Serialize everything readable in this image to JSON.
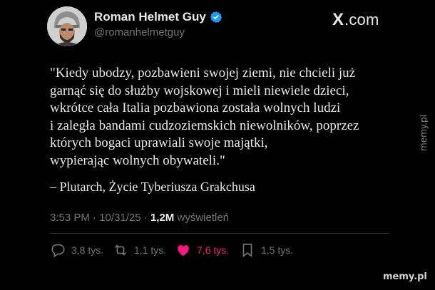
{
  "author": {
    "display_name": "Roman Helmet Guy",
    "handle": "@romanhelmetguy",
    "verified": true
  },
  "brand": {
    "logo": "X",
    "domain": ".com"
  },
  "tweet": {
    "quote_lines": [
      "\"Kiedy ubodzy, pozbawieni swojej ziemi, nie chcieli już",
      "garnąć się do służby wojskowej i mieli niewiele dzieci,",
      "wkrótce cała Italia pozbawiona została wolnych ludzi",
      "i zaległa bandami cudzoziemskich niewolników, poprzez",
      "których bogaci uprawiali swoje majątki,",
      "wypierając wolnych obywateli.\""
    ],
    "attribution": "– Plutarch, Życie Tyberiusza Grakchusa"
  },
  "meta": {
    "time": "3:53 PM",
    "separator": "·",
    "date": "10/31/25",
    "views_count": "1,2M",
    "views_label": "wyświetleń"
  },
  "actions": {
    "replies": "3,8 tys.",
    "reposts": "1,1 tys.",
    "likes": "7,6 tys.",
    "bookmarks": "1,5 tys."
  },
  "colors": {
    "accent_like": "#f91880",
    "verified": "#1d9bf0",
    "muted": "#71767b"
  },
  "watermarks": {
    "side": "memy.pl",
    "bottom": "memy.pl"
  }
}
